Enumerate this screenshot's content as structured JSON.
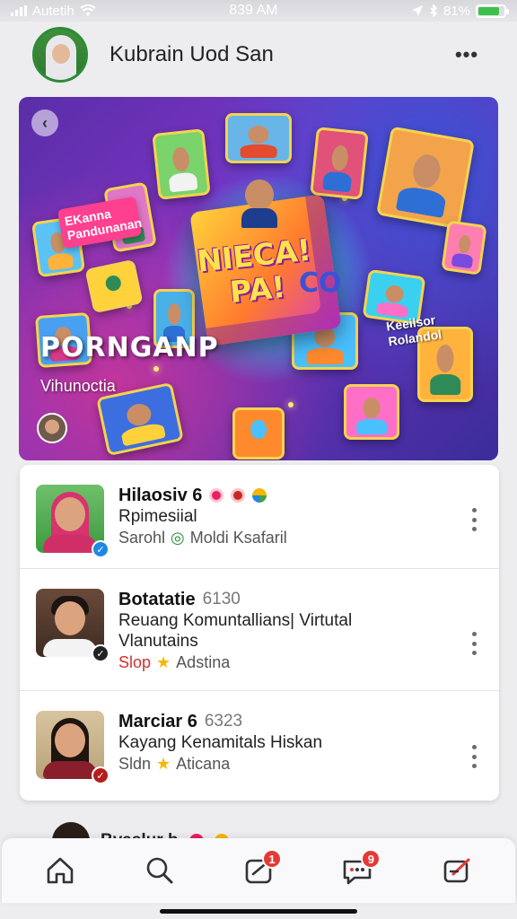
{
  "status_bar": {
    "carrier": "Autetih",
    "time": "839 AM",
    "battery": "81%",
    "battery_level": 0.81
  },
  "header": {
    "profile_name": "Kubrain Uod San",
    "more_label": "•••"
  },
  "hero": {
    "bubble_text": "EKanna Pandunanan",
    "cube_text": "NIECA! PA!",
    "cube_side_text": "CO",
    "side_text": "Keeilsor Rolandol",
    "title": "PORNGANP",
    "subtitle": "Vihunoctia",
    "back_icon": "chevron-left-icon"
  },
  "list": {
    "items": [
      {
        "title": "Hilaosiv 6",
        "line1": "Rpimesiial",
        "meta_a": "Sarohl",
        "meta_b": "Moldi Ksafaril",
        "badge_color": "#1e88e5",
        "badge_symbol": "✓"
      },
      {
        "title": "Botatatie",
        "code": "6130",
        "line1": "Reuang Komuntallians| Virtutal",
        "line2": "Vlanutains",
        "meta_a": "Slop",
        "meta_b": "Adstina",
        "badge_color": "#222222",
        "badge_symbol": "✓"
      },
      {
        "title": "Marciar 6",
        "code": "6323",
        "line1": "Kayang Kenamitals Hiskan",
        "meta_a": "Sldn",
        "meta_b": "Aticana",
        "badge_color": "#b71c1c",
        "badge_symbol": "✓"
      }
    ]
  },
  "peek": {
    "name": "Byaslur b"
  },
  "nav": {
    "items": [
      {
        "name": "home",
        "badge": ""
      },
      {
        "name": "search",
        "badge": ""
      },
      {
        "name": "notifications",
        "badge": "1"
      },
      {
        "name": "messages",
        "badge": "9"
      },
      {
        "name": "compose",
        "badge": ""
      }
    ]
  },
  "colors": {
    "accent_red": "#e53935",
    "hero_purple": "#6a30b8",
    "brand_green": "#2e8b37"
  }
}
